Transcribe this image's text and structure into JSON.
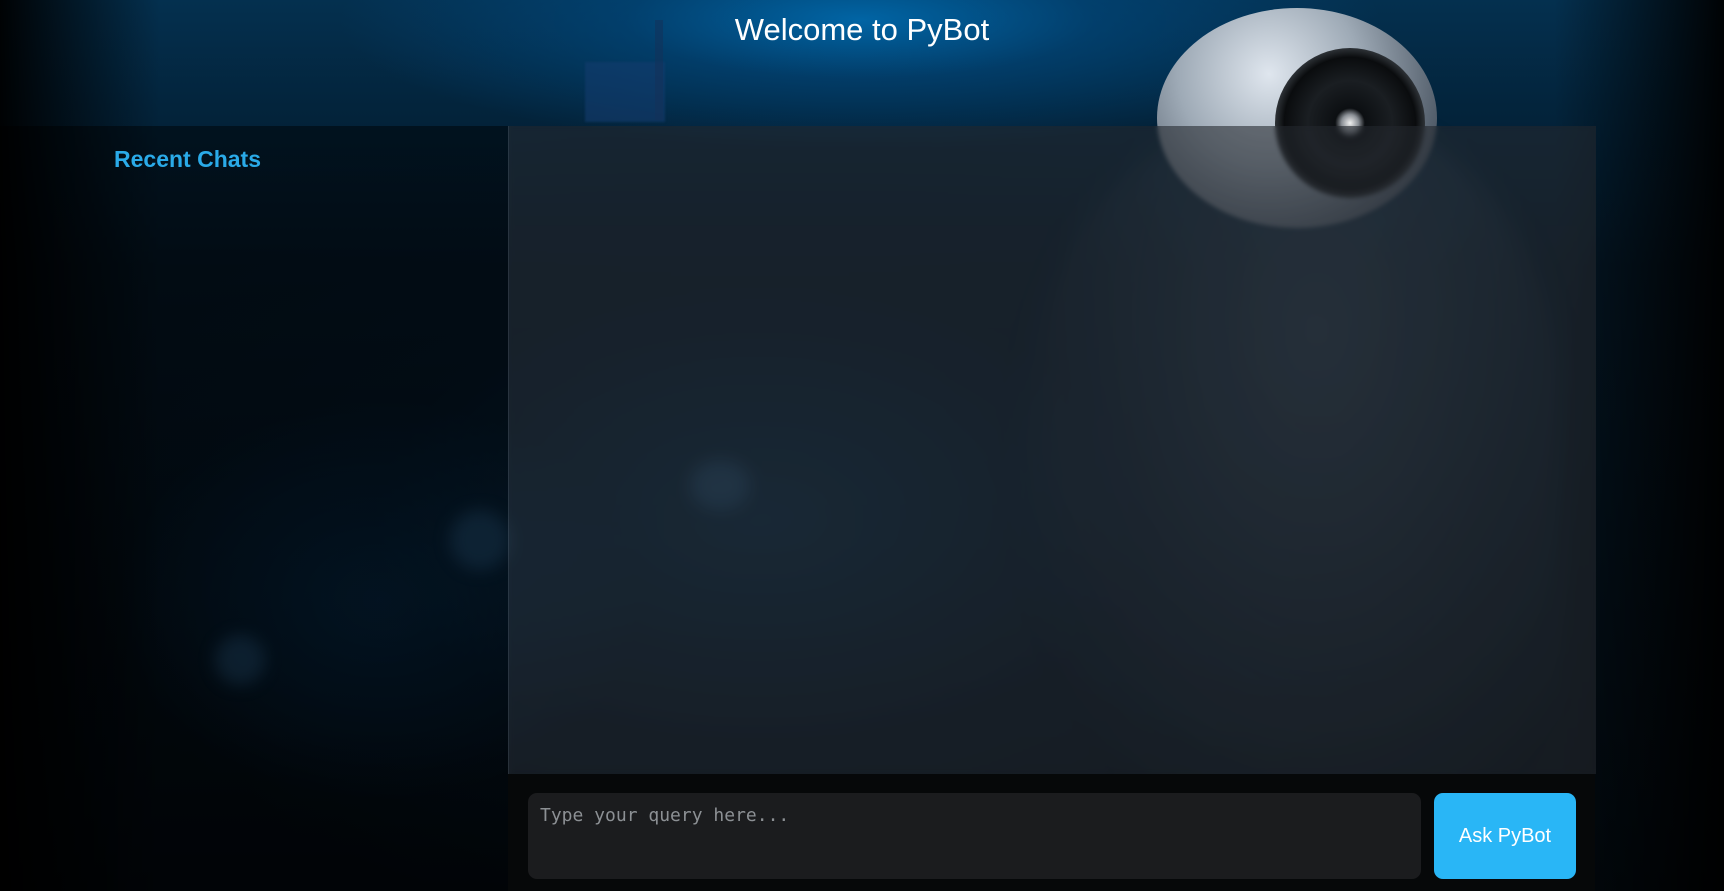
{
  "header": {
    "title": "Welcome to PyBot"
  },
  "sidebar": {
    "title": "Recent Chats",
    "items": []
  },
  "chat": {
    "messages": []
  },
  "composer": {
    "placeholder": "Type your query here...",
    "value": "",
    "submit_label": "Ask PyBot"
  },
  "theme": {
    "accent": "#29b6f6",
    "sidebar_title_color": "#2aaae8",
    "input_background": "#1b1c1e"
  }
}
